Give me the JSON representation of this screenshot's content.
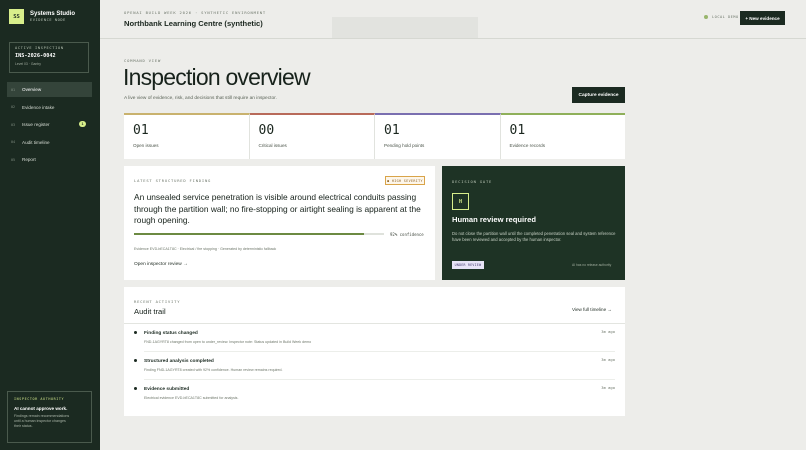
{
  "sidebar": {
    "brand": {
      "logo": "SS",
      "name": "Systems Studio",
      "subtitle": "EVIDENCE NODE"
    },
    "active_inspection": {
      "label": "ACTIVE INSPECTION",
      "id": "INS-2026-0042",
      "level": "Level 03 · Gantry"
    },
    "nav": [
      {
        "num": "01",
        "label": "Overview",
        "active": true
      },
      {
        "num": "02",
        "label": "Evidence intake"
      },
      {
        "num": "03",
        "label": "Issue register",
        "badge": "1"
      },
      {
        "num": "04",
        "label": "Audit timeline"
      },
      {
        "num": "05",
        "label": "Report"
      }
    ],
    "authority": {
      "label": "INSPECTOR AUTHORITY",
      "title": "AI cannot approve work.",
      "desc_lines": [
        "Findings remain recommendations",
        "until a human inspector changes",
        "their status."
      ]
    }
  },
  "header": {
    "kicker": "OPENAI BUILD WEEK 2026  ·  SYNTHETIC ENVIRONMENT",
    "site": "Northbank Learning Centre (synthetic)",
    "local_badge": "LOCAL DEMO",
    "new_evidence": "+ New evidence"
  },
  "command": {
    "kicker": "COMMAND VIEW",
    "title": "Inspection overview",
    "subtitle": "A live view of evidence, risk, and decisions that still require an inspector.",
    "capture": "Capture evidence"
  },
  "metrics": [
    {
      "value": "01",
      "label": "Open issues",
      "accent": "#c9b26e"
    },
    {
      "value": "00",
      "label": "Critical issues",
      "accent": "#b86a5a"
    },
    {
      "value": "01",
      "label": "Pending hold points",
      "accent": "#7a6fb0"
    },
    {
      "value": "01",
      "label": "Evidence records",
      "accent": "#8fb05a"
    }
  ],
  "finding": {
    "kicker": "LATEST STRUCTURED FINDING",
    "severity": "● HIGH SEVERITY",
    "title": "An unsealed service penetration is visible around electrical conduits passing through the partition wall; no fire-stopping or airtight sealing is apparent at the rough opening.",
    "confidence": 0.92,
    "confidence_label": "92% confidence",
    "evidence": "Evidence EVD-bECA1T8C · Electrical / fire stopping · Generated by deterministic fallback",
    "open_review": "Open inspector review  →"
  },
  "gate": {
    "kicker": "DECISION GATE",
    "letter": "H",
    "title": "Human review required",
    "desc": "Do not close the partition wall until the completed penetration seal and system reference have been reviewed and accepted by the human inspector.",
    "badge": "UNDER REVIEW",
    "note": "AI has no release authority"
  },
  "activity": {
    "kicker": "RECENT ACTIVITY",
    "title": "Audit trail",
    "link": "View full timeline →",
    "events": [
      {
        "title": "Finding status changed",
        "desc": "FND-1AGYRT8 changed from open to under_review. Inspector note: Status updated in Build Week demo",
        "ago": "3m ago"
      },
      {
        "title": "Structured analysis completed",
        "desc": "Finding FND-1AGYRT8 created with 92% confidence. Human review remains required.",
        "ago": "3m ago"
      },
      {
        "title": "Evidence submitted",
        "desc": "Electrical evidence EVD-bECA1T8C submitted for analysis.",
        "ago": "3m ago"
      }
    ]
  }
}
